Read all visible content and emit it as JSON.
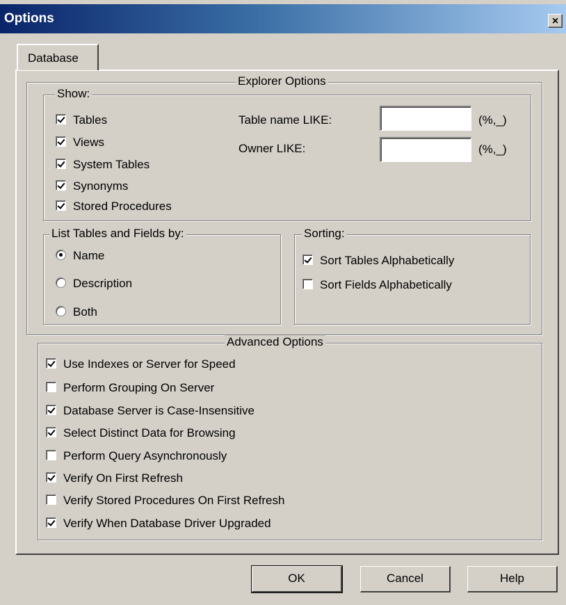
{
  "window": {
    "title": "Options",
    "close_label": "×"
  },
  "tabs": [
    {
      "label": "Database"
    }
  ],
  "explorer": {
    "title": "Explorer Options",
    "show": {
      "title": "Show:",
      "items": [
        {
          "label": "Tables",
          "checked": true
        },
        {
          "label": "Views",
          "checked": true
        },
        {
          "label": "System Tables",
          "checked": true
        },
        {
          "label": "Synonyms",
          "checked": true
        },
        {
          "label": "Stored Procedures",
          "checked": true
        }
      ]
    },
    "table_name_like": {
      "label": "Table name LIKE:",
      "value": "",
      "hint": "(%,_)"
    },
    "owner_like": {
      "label": "Owner LIKE:",
      "value": "",
      "hint": "(%,_)"
    },
    "list_by": {
      "title": "List Tables and Fields by:",
      "options": [
        {
          "label": "Name",
          "selected": true
        },
        {
          "label": "Description",
          "selected": false
        },
        {
          "label": "Both",
          "selected": false
        }
      ]
    },
    "sorting": {
      "title": "Sorting:",
      "items": [
        {
          "label": "Sort Tables Alphabetically",
          "checked": true
        },
        {
          "label": "Sort Fields Alphabetically",
          "checked": false
        }
      ]
    }
  },
  "advanced": {
    "title": "Advanced Options",
    "items": [
      {
        "label": "Use Indexes or Server for Speed",
        "checked": true
      },
      {
        "label": "Perform Grouping On Server",
        "checked": false
      },
      {
        "label": "Database Server is Case-Insensitive",
        "checked": true
      },
      {
        "label": "Select Distinct Data for Browsing",
        "checked": true
      },
      {
        "label": "Perform Query Asynchronously",
        "checked": false
      },
      {
        "label": "Verify On First Refresh",
        "checked": true
      },
      {
        "label": "Verify Stored Procedures On First Refresh",
        "checked": false
      },
      {
        "label": "Verify When Database Driver Upgraded",
        "checked": true
      }
    ]
  },
  "buttons": {
    "ok": "OK",
    "cancel": "Cancel",
    "help": "Help"
  }
}
